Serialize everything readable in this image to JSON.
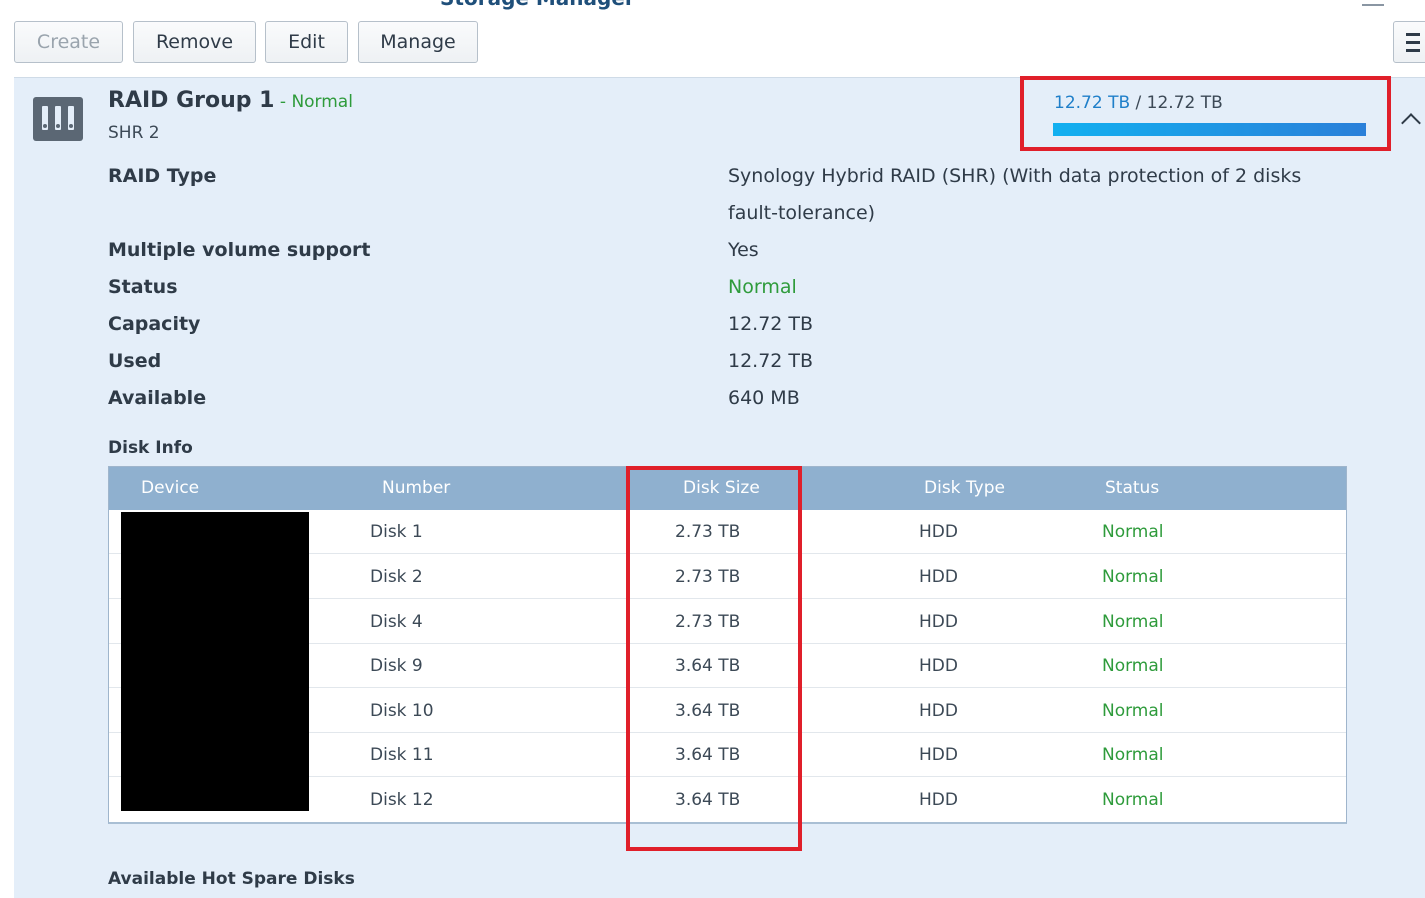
{
  "window": {
    "title": "Storage Manager"
  },
  "toolbar": {
    "create_label": "Create",
    "remove_label": "Remove",
    "edit_label": "Edit",
    "manage_label": "Manage"
  },
  "raid_group": {
    "name": "RAID Group 1",
    "separator": " - ",
    "status": "Normal",
    "type_short": "SHR 2",
    "usage": {
      "used": "12.72 TB",
      "divider": " / ",
      "total": "12.72 TB",
      "fraction_used": 1.0
    },
    "properties": [
      {
        "label": "RAID Type",
        "value": "Synology Hybrid RAID (SHR) (With data protection of 2 disks",
        "value_cont": "fault-tolerance)"
      },
      {
        "label": "Multiple volume support",
        "value": "Yes"
      },
      {
        "label": "Status",
        "value": "Normal"
      },
      {
        "label": "Capacity",
        "value": "12.72 TB"
      },
      {
        "label": "Used",
        "value": "12.72 TB"
      },
      {
        "label": "Available",
        "value": "640 MB"
      }
    ]
  },
  "disk_info": {
    "title": "Disk Info",
    "columns": [
      "Device",
      "Number",
      "Disk Size",
      "Disk Type",
      "Status"
    ],
    "rows": [
      {
        "number": "Disk 1",
        "size": "2.73 TB",
        "type": "HDD",
        "status": "Normal"
      },
      {
        "number": "Disk 2",
        "size": "2.73 TB",
        "type": "HDD",
        "status": "Normal"
      },
      {
        "number": "Disk 4",
        "size": "2.73 TB",
        "type": "HDD",
        "status": "Normal"
      },
      {
        "number": "Disk 9",
        "size": "3.64 TB",
        "type": "HDD",
        "status": "Normal"
      },
      {
        "number": "Disk 10",
        "size": "3.64 TB",
        "type": "HDD",
        "status": "Normal"
      },
      {
        "number": "Disk 11",
        "size": "3.64 TB",
        "type": "HDD",
        "status": "Normal"
      },
      {
        "number": "Disk 12",
        "size": "3.64 TB",
        "type": "HDD",
        "status": "Normal"
      }
    ]
  },
  "hot_spare": {
    "title": "Available Hot Spare Disks"
  },
  "colors": {
    "accent": "#1f7fc9",
    "status_ok": "#2e9b3b",
    "highlight": "#e01f2a",
    "panel_bg": "#e4eef9",
    "table_header": "#8fb0cf"
  },
  "icons": {
    "raid": "raid-disks-icon",
    "collapse": "chevron-up-icon",
    "view": "view-toggle-icon"
  }
}
